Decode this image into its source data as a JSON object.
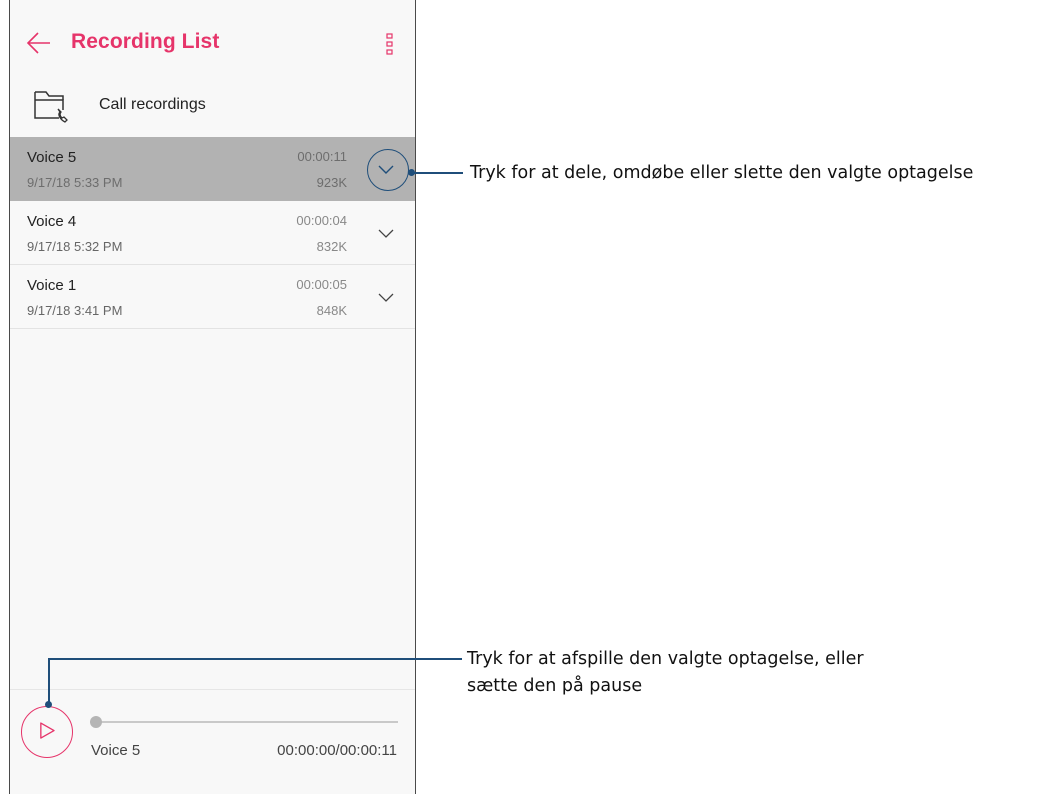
{
  "header": {
    "back_icon": "arrow-left-icon",
    "title": "Recording List",
    "menu_icon": "more-vertical-icon"
  },
  "folder": {
    "icon": "folder-call-icon",
    "label": "Call recordings"
  },
  "recordings": [
    {
      "name": "Voice 5",
      "date": "9/17/18 5:33 PM",
      "duration": "00:00:11",
      "size": "923K",
      "selected": true
    },
    {
      "name": "Voice 4",
      "date": "9/17/18 5:32 PM",
      "duration": "00:00:04",
      "size": "832K",
      "selected": false
    },
    {
      "name": "Voice 1",
      "date": "9/17/18 3:41 PM",
      "duration": "00:00:05",
      "size": "848K",
      "selected": false
    }
  ],
  "player": {
    "play_icon": "play-icon",
    "track_name": "Voice 5",
    "time": "00:00:00/00:00:11",
    "progress_fraction": 0
  },
  "callouts": {
    "options": "Tryk for at dele, omdøbe eller slette den valgte optagelse",
    "play_line1": "Tryk for at afspille den valgte optagelse, eller",
    "play_line2": "sætte den på pause"
  },
  "colors": {
    "accent": "#e6346a",
    "selected_row": "#b2b2b2",
    "callout": "#1f4e7a"
  }
}
